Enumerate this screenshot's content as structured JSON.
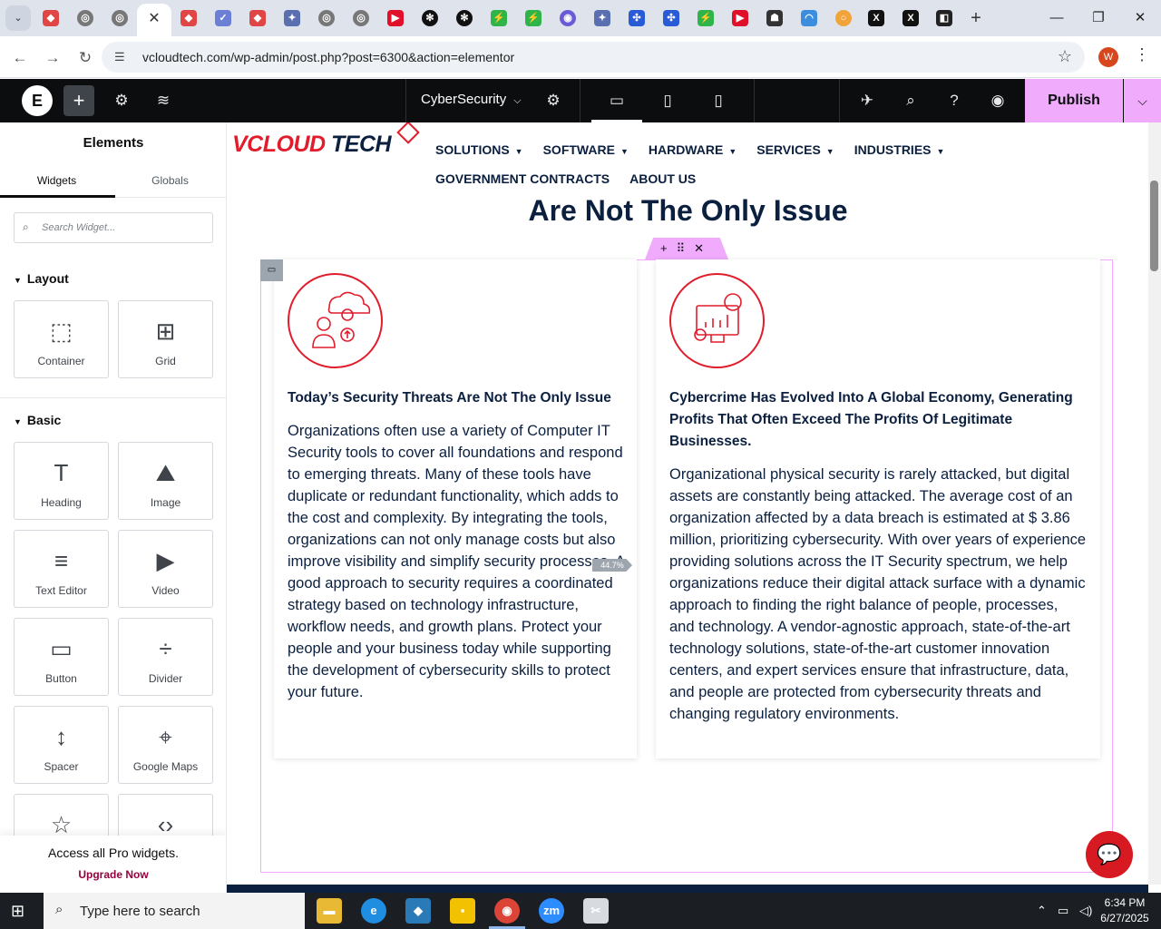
{
  "browser": {
    "url": "vcloudtech.com/wp-admin/post.php?post=6300&action=elementor",
    "active_tab_close": "✕",
    "profile_initial": "W"
  },
  "editor": {
    "doc_name": "CyberSecurity",
    "publish_label": "Publish",
    "panel_title": "Elements",
    "tabs": [
      "Widgets",
      "Globals"
    ],
    "search_placeholder": "Search Widget...",
    "layout_label": "Layout",
    "basic_label": "Basic",
    "layout_widgets": [
      "Container",
      "Grid"
    ],
    "basic_widgets": [
      "Heading",
      "Image",
      "Text Editor",
      "Video",
      "Button",
      "Divider",
      "Spacer",
      "Google Maps"
    ],
    "pro_text": "Access all Pro widgets.",
    "pro_link": "Upgrade Now",
    "column_width": "44.7%"
  },
  "site": {
    "logo_v": "VCLOUD",
    "logo_tech": " TECH",
    "menu_row1": [
      "SOLUTIONS",
      "SOFTWARE",
      "HARDWARE",
      "SERVICES",
      "INDUSTRIES"
    ],
    "menu_row2": [
      "GOVERNMENT CONTRACTS",
      "ABOUT US"
    ],
    "section_title": "Are Not The Only Issue",
    "cards": [
      {
        "title": "Today’s Security Threats Are Not The Only Issue",
        "body": "Organizations often use a variety of Computer IT Security tools to cover all foundations and respond to emerging threats. Many of these tools have duplicate or redundant functionality, which adds to the cost and complexity. By integrating the tools, organizations can not only manage costs but also improve visibility and simplify security processes. A good approach to security requires a coordinated strategy based on technology infrastructure, workflow needs, and growth plans. Protect your people and your business today while supporting the development of cybersecurity skills to protect your future."
      },
      {
        "title": "Cybercrime Has Evolved Into A Global Economy, Generating Profits That Often Exceed The Profits Of Legitimate Businesses.",
        "body": "Organizational physical security is rarely attacked, but digital assets are constantly being attacked. The average cost of an organization affected by a data breach is estimated at $ 3.86 million, prioritizing cybersecurity. With over years of experience providing solutions across the IT Security spectrum, we help organizations reduce their digital attack surface with a dynamic approach to finding the right balance of people, processes, and technology. A vendor-agnostic approach, state-of-the-art technology solutions, state-of-the-art customer innovation centers, and expert services ensure that infrastructure, data, and people are protected from cybersecurity threats and changing regulatory environments."
      }
    ]
  },
  "taskbar": {
    "search_text": "Type here to search",
    "time": "6:34 PM",
    "date": "6/27/2025"
  },
  "colors": {
    "accent_publish": "#f0abfc",
    "brand_red": "#e11d2c",
    "brand_navy": "#0b1f3f"
  }
}
